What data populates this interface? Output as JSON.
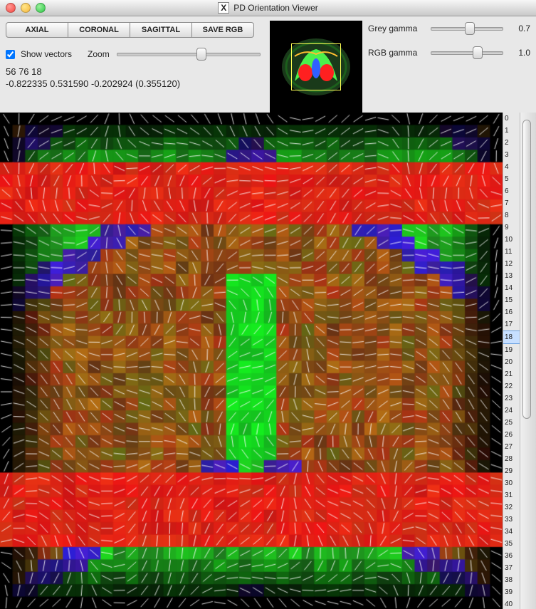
{
  "title": "PD Orientation Viewer",
  "buttons": {
    "axial": "AXIAL",
    "coronal": "CORONAL",
    "sagittal": "SAGITTAL",
    "save": "SAVE RGB"
  },
  "show_vectors_label": "Show vectors",
  "show_vectors": true,
  "zoom_label": "Zoom",
  "zoom": 0.6,
  "coords_line1": "56 76 18",
  "coords_line2": "-0.822335 0.531590 -0.202924 (0.355120)",
  "grey_gamma_label": "Grey gamma",
  "grey_gamma_value": "0.7",
  "grey_gamma_pos": 0.55,
  "rgb_gamma_label": "RGB gamma",
  "rgb_gamma_value": "1.0",
  "rgb_gamma_pos": 0.68,
  "ruler_max": 40,
  "ruler_selected": 18
}
